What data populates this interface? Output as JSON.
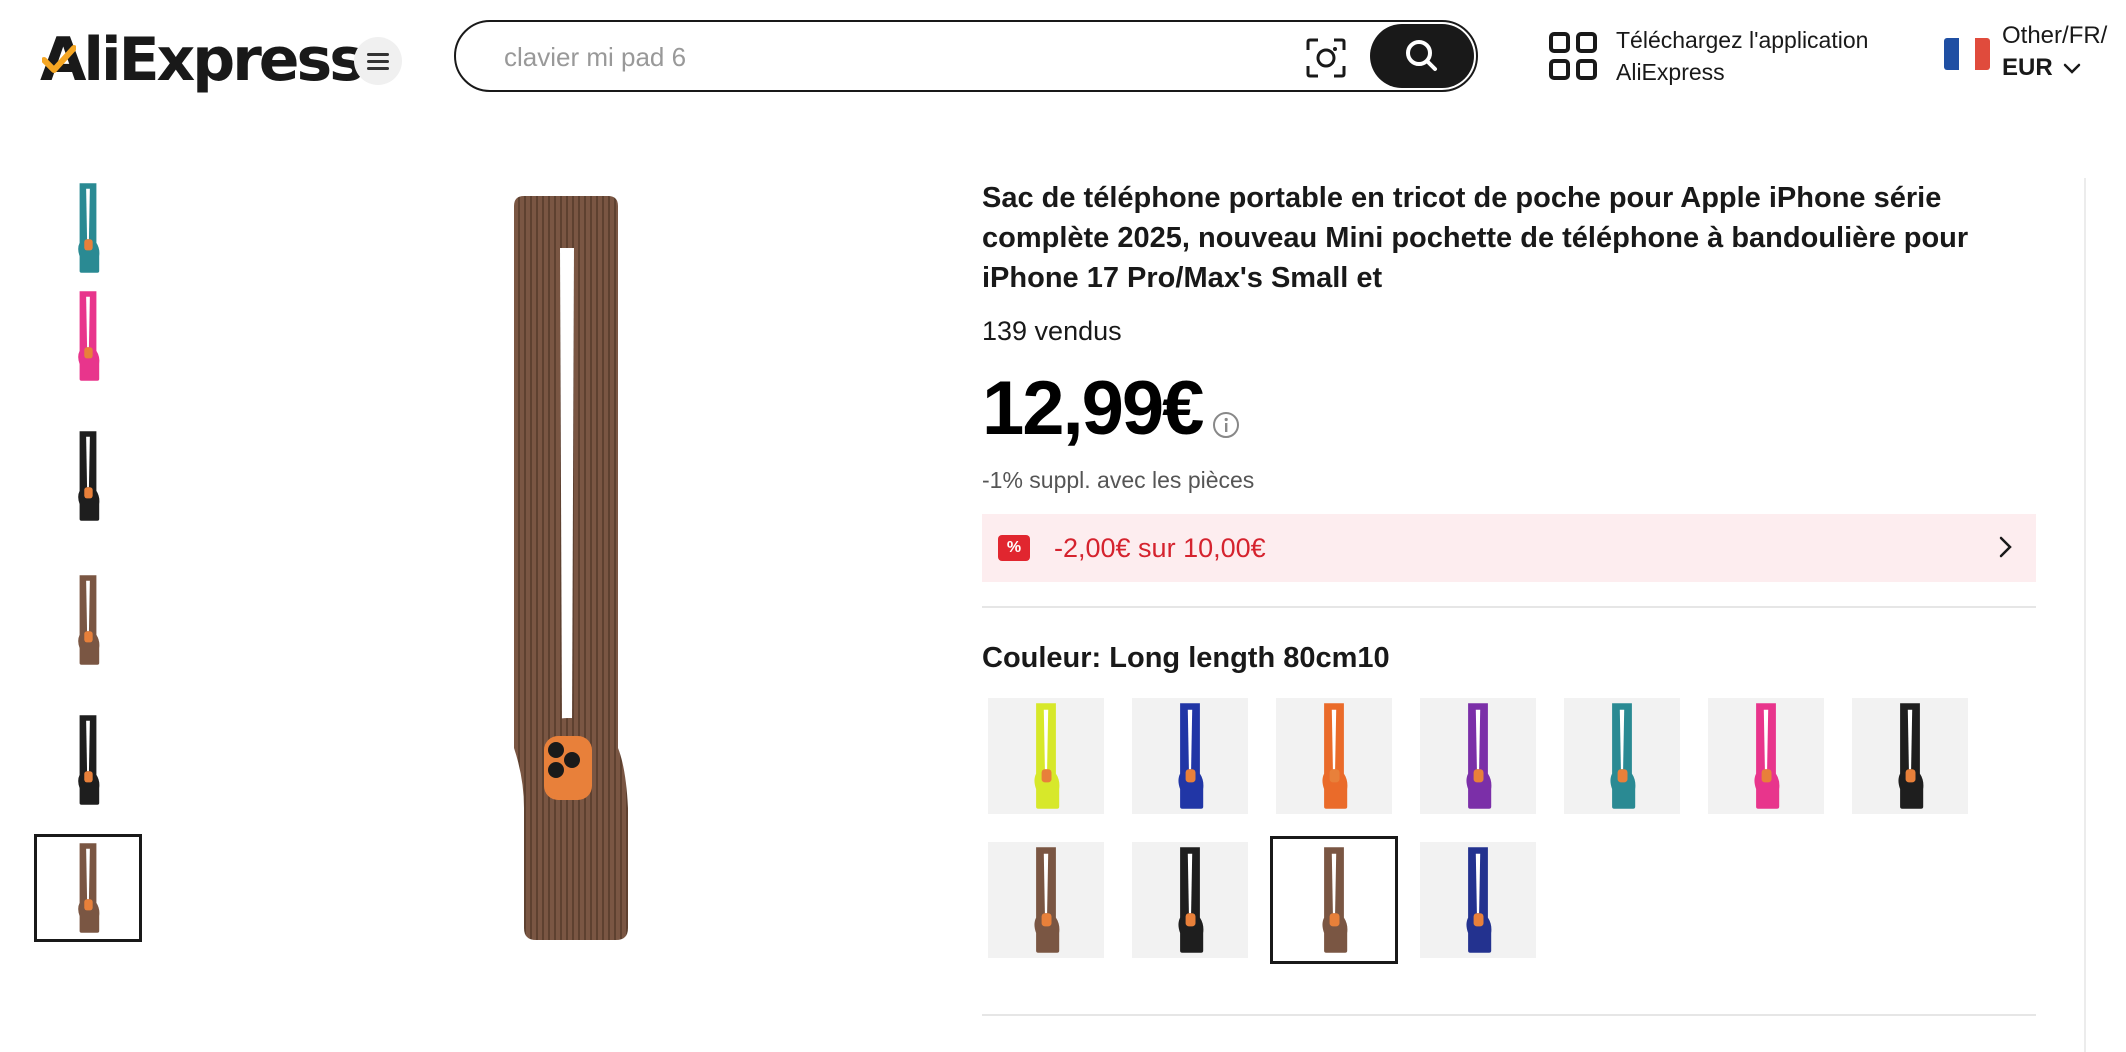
{
  "header": {
    "logo": "AliExpress",
    "search_placeholder": "clavier mi pad 6",
    "app_download_line1": "Téléchargez l'application",
    "app_download_line2": "AliExpress",
    "locale_line": "Other/FR/",
    "currency": "EUR"
  },
  "product": {
    "title": "Sac de téléphone portable en tricot de poche pour Apple iPhone série complète 2025, nouveau Mini pochette de téléphone à bandoulière pour iPhone 17 Pro/Max's Small et",
    "sold": "139 vendus",
    "price": "12,99€",
    "coins_note": "-1% suppl. avec les pièces",
    "coupon_badge": "%",
    "coupon_text": "-2,00€ sur 10,00€",
    "color_label": "Couleur:",
    "color_value": "Long length 80cm10"
  },
  "colors": {
    "thumbs": [
      "#2a8a93",
      "#e8358c",
      "#1e1e1e",
      "#7a5643",
      "#1e1e1e",
      "#7a5643"
    ],
    "active_thumb": 5,
    "main": "#7a5643",
    "swatches": [
      "#d7e82a",
      "#2136a6",
      "#ea6b2a",
      "#7b2fa8",
      "#2a8a93",
      "#e8358c",
      "#1e1e1e",
      "#7a5643",
      "#1e1e1e",
      "#7a5643",
      "#23328f"
    ],
    "selected_swatch": 9,
    "coupon_red": "#d5232e",
    "flag": [
      "#1f4fa3",
      "#ffffff",
      "#e04b3c"
    ]
  }
}
